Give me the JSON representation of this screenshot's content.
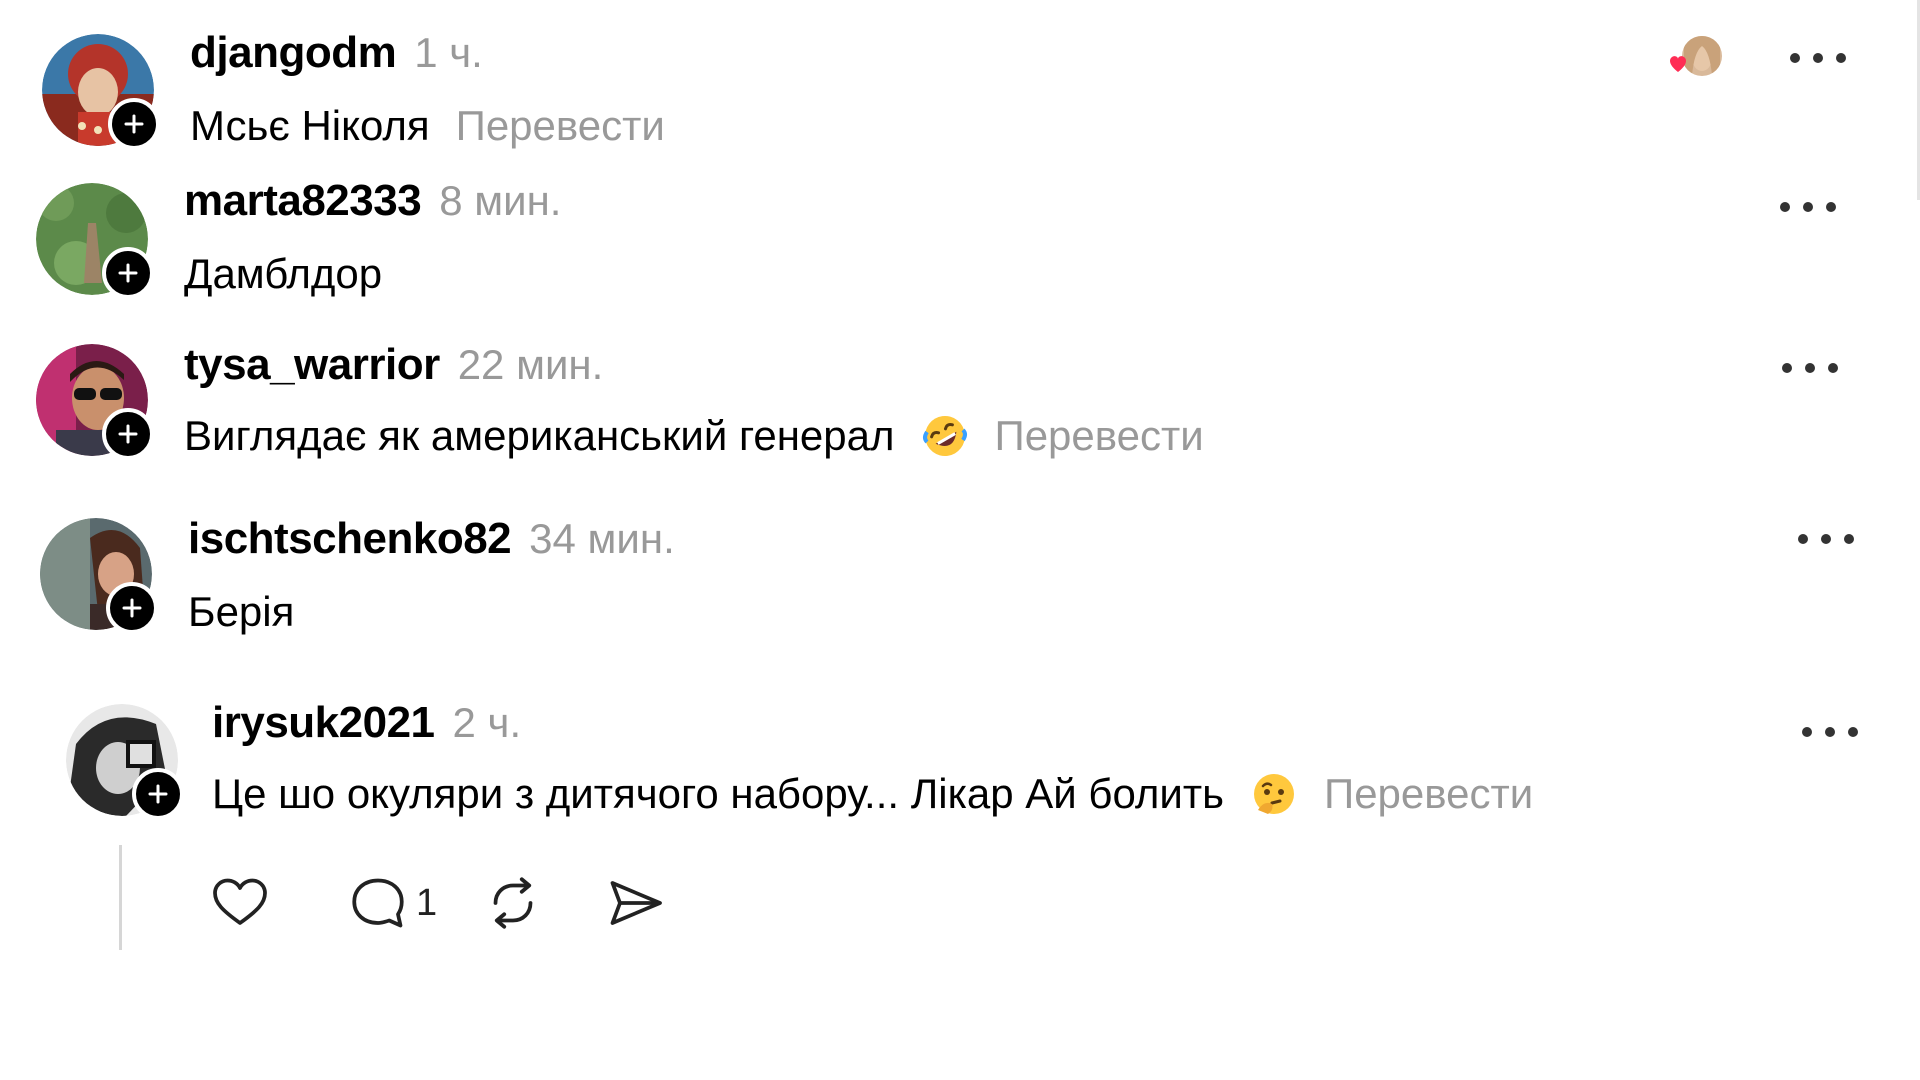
{
  "colors": {
    "text": "#000000",
    "muted": "#999999",
    "badge": "#000000",
    "heart": "#ff2d55",
    "thread_line": "#d6d6d6"
  },
  "comments": [
    {
      "username": "djangodm",
      "time": "1 ч.",
      "text": "Мсьє Ніколя",
      "translate": "Перевести",
      "avatar": "avatar-costume",
      "liked_by_author": true
    },
    {
      "username": "marta82333",
      "time": "8 мин.",
      "text": "Дамблдор",
      "avatar": "avatar-green"
    },
    {
      "username": "tysa_warrior",
      "time": "22 мин.",
      "text": "Виглядає як американський генерал",
      "emoji": "rolling-on-floor-laughing",
      "translate": "Перевести",
      "avatar": "avatar-sunglasses"
    },
    {
      "username": "ischtschenko82",
      "time": "34 мин.",
      "text": "Берія",
      "avatar": "avatar-brunette"
    },
    {
      "username": "irysuk2021",
      "time": "2 ч.",
      "text": "Це шо окуляри з дитячого набору... Лікар Ай болить",
      "emoji": "thinking-face",
      "translate": "Перевести",
      "avatar": "avatar-bw"
    }
  ],
  "actions": {
    "like": "heart-icon",
    "reply": "comment-bubble-icon",
    "reply_count": "1",
    "repost": "repost-icon",
    "share": "send-icon"
  }
}
